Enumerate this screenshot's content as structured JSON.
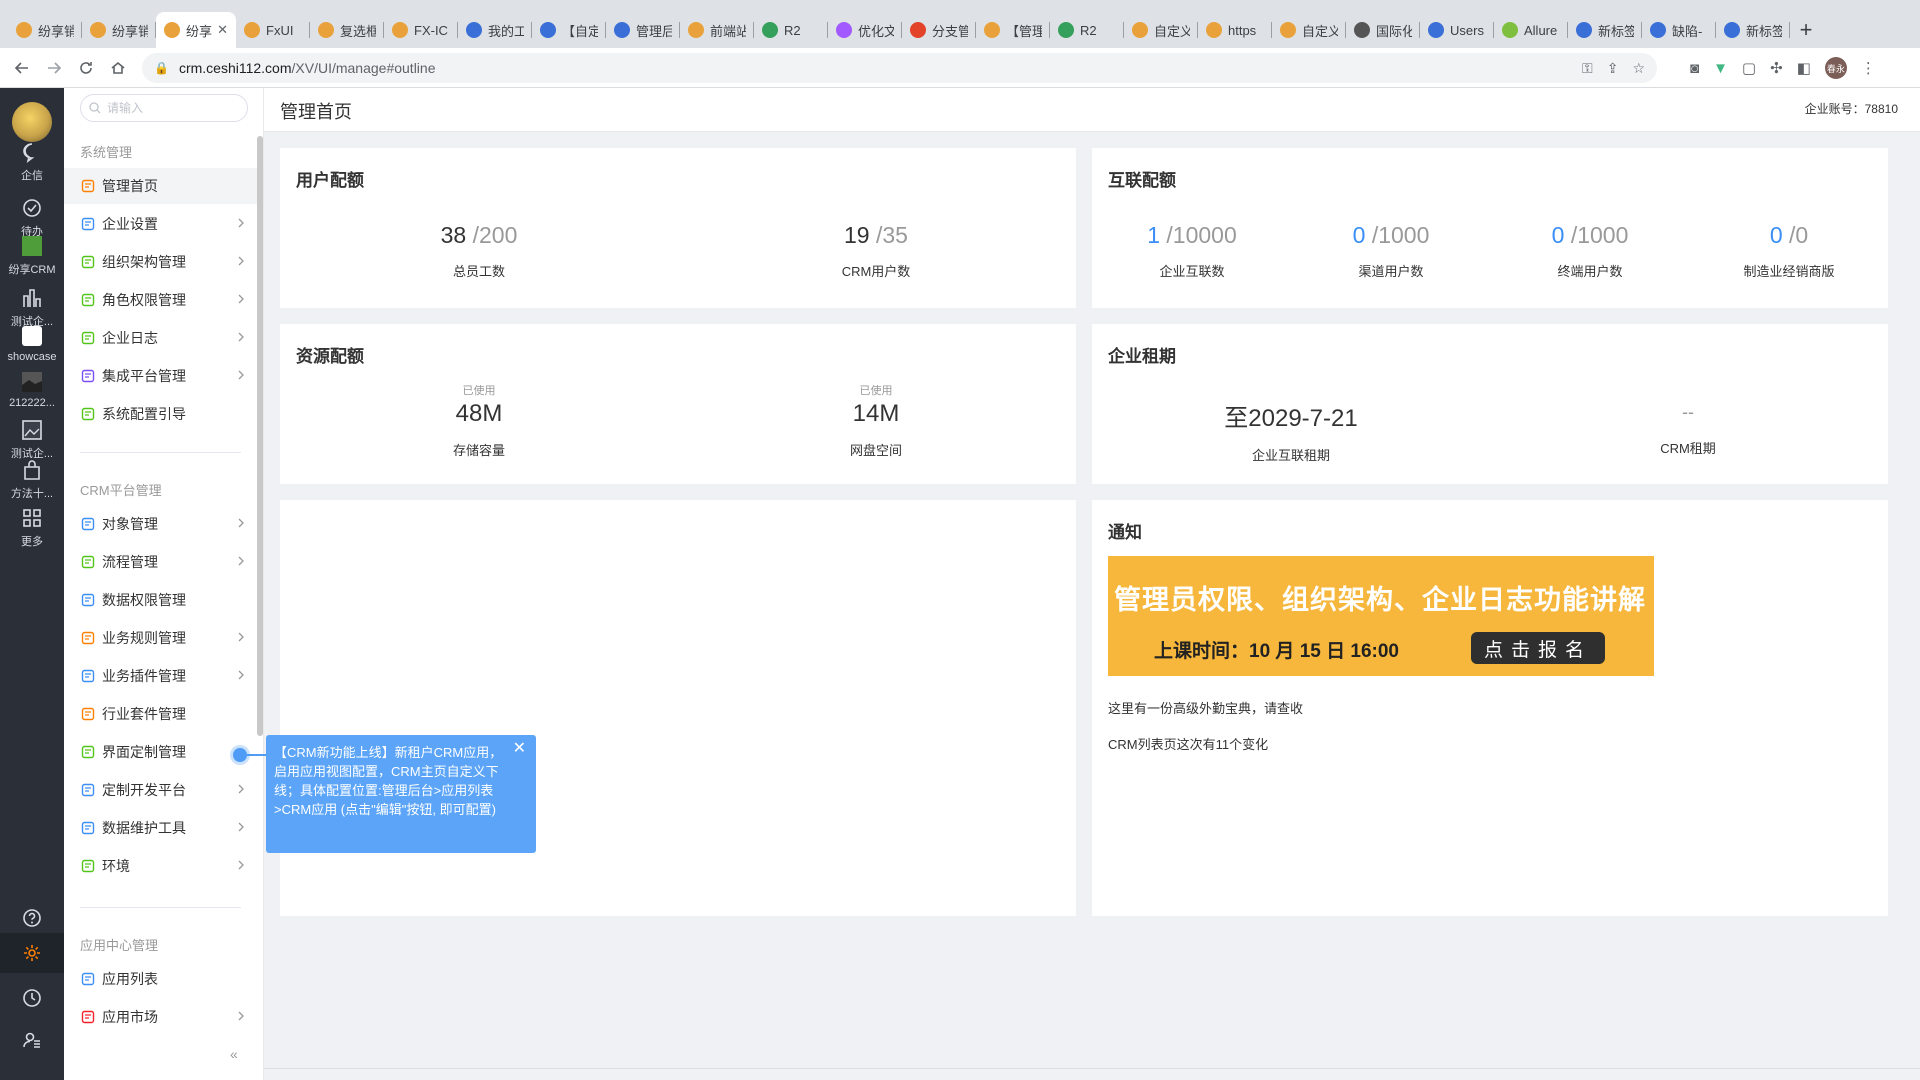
{
  "browser": {
    "tabs": [
      {
        "title": "纷享销",
        "color": "#e9a23b"
      },
      {
        "title": "纷享销",
        "color": "#e9a23b"
      },
      {
        "title": "纷享",
        "color": "#e9a23b",
        "active": true
      },
      {
        "title": "FxUI",
        "color": "#e9a23b"
      },
      {
        "title": "复选框",
        "color": "#e9a23b"
      },
      {
        "title": "FX-IC",
        "color": "#e9a23b"
      },
      {
        "title": "我的工",
        "color": "#3b6fd8"
      },
      {
        "title": "【自定",
        "color": "#3b6fd8"
      },
      {
        "title": "管理后",
        "color": "#3b6fd8"
      },
      {
        "title": "前端站",
        "color": "#e9a23b"
      },
      {
        "title": "R2",
        "color": "#35a05b"
      },
      {
        "title": "优化文",
        "color": "#a259ff"
      },
      {
        "title": "分支管",
        "color": "#e24329"
      },
      {
        "title": "【管理",
        "color": "#e9a23b"
      },
      {
        "title": "R2",
        "color": "#35a05b"
      },
      {
        "title": "自定义",
        "color": "#e9a23b"
      },
      {
        "title": "https",
        "color": "#e9a23b"
      },
      {
        "title": "自定义",
        "color": "#e9a23b"
      },
      {
        "title": "国际化",
        "color": "#555555"
      },
      {
        "title": "Users",
        "color": "#3b6fd8"
      },
      {
        "title": "Allure",
        "color": "#7fbf3f"
      },
      {
        "title": "新标签",
        "color": "#3b6fd8"
      },
      {
        "title": "缺陷-",
        "color": "#3b6fd8"
      },
      {
        "title": "新标签",
        "color": "#3b6fd8"
      }
    ],
    "tab_close": "✕",
    "new_tab": "+",
    "url_host": "crm.ceshi112.com",
    "url_path": "/XV/UI/manage#outline",
    "profile_label": "春永"
  },
  "rail": {
    "items": [
      {
        "label": "企信",
        "icon": "chat-bubble-icon"
      },
      {
        "label": "待办",
        "icon": "check-circle-icon"
      },
      {
        "label": "纷享CRM",
        "icon": "crm-app-icon"
      },
      {
        "label": "测试企...",
        "icon": "bar-chart-icon"
      },
      {
        "label": "showcase",
        "icon": "showcase-app-icon"
      },
      {
        "label": "212222...",
        "icon": "image-app-icon"
      },
      {
        "label": "测试企...",
        "icon": "picture-icon"
      },
      {
        "label": "方法十...",
        "icon": "bag-icon"
      },
      {
        "label": "更多",
        "icon": "grid-icon"
      }
    ]
  },
  "menu": {
    "search_placeholder": "请输入",
    "groups": {
      "system": "系统管理",
      "crm": "CRM平台管理",
      "app": "应用中心管理"
    },
    "system_items": [
      {
        "label": "管理首页",
        "arrow": false,
        "active": true,
        "color": "#ff8000"
      },
      {
        "label": "企业设置",
        "arrow": true,
        "color": "#3a8ef6"
      },
      {
        "label": "组织架构管理",
        "arrow": true,
        "color": "#52c41a"
      },
      {
        "label": "角色权限管理",
        "arrow": true,
        "color": "#52c41a"
      },
      {
        "label": "企业日志",
        "arrow": true,
        "color": "#52c41a"
      },
      {
        "label": "集成平台管理",
        "arrow": true,
        "color": "#7a4ff7"
      },
      {
        "label": "系统配置引导",
        "arrow": false,
        "color": "#52c41a"
      }
    ],
    "crm_items": [
      {
        "label": "对象管理",
        "arrow": true,
        "color": "#3a8ef6"
      },
      {
        "label": "流程管理",
        "arrow": true,
        "color": "#52c41a"
      },
      {
        "label": "数据权限管理",
        "arrow": false,
        "color": "#3a8ef6"
      },
      {
        "label": "业务规则管理",
        "arrow": true,
        "color": "#ff8000"
      },
      {
        "label": "业务插件管理",
        "arrow": true,
        "color": "#3a8ef6"
      },
      {
        "label": "行业套件管理",
        "arrow": false,
        "color": "#ff8000"
      },
      {
        "label": "界面定制管理",
        "arrow": false,
        "color": "#52c41a"
      },
      {
        "label": "定制开发平台",
        "arrow": true,
        "color": "#3a8ef6"
      },
      {
        "label": "数据维护工具",
        "arrow": true,
        "color": "#3a8ef6"
      },
      {
        "label": "环境",
        "arrow": true,
        "color": "#52c41a"
      }
    ],
    "app_items": [
      {
        "label": "应用列表",
        "arrow": false,
        "color": "#3a8ef6"
      },
      {
        "label": "应用市场",
        "arrow": true,
        "color": "#f5222d"
      }
    ],
    "collapse": "«"
  },
  "header": {
    "title": "管理首页",
    "account_label": "企业账号：",
    "account_value": "78810"
  },
  "user_quota": {
    "title": "用户配额",
    "stats": [
      {
        "value": "38",
        "total": "/200",
        "caption": "总员工数"
      },
      {
        "value": "19",
        "total": "/35",
        "caption": "CRM用户数"
      }
    ]
  },
  "interconnect_quota": {
    "title": "互联配额",
    "stats": [
      {
        "value": "1",
        "total": "/10000",
        "caption": "企业互联数"
      },
      {
        "value": "0",
        "total": "/1000",
        "caption": "渠道用户数"
      },
      {
        "value": "0",
        "total": "/1000",
        "caption": "终端用户数"
      },
      {
        "value": "0",
        "total": "/0",
        "caption": "制造业经销商版"
      }
    ]
  },
  "resource_quota": {
    "title": "资源配额",
    "stats": [
      {
        "used_label": "已使用",
        "value": "48M",
        "caption": "存储容量"
      },
      {
        "used_label": "已使用",
        "value": "14M",
        "caption": "网盘空间"
      }
    ]
  },
  "lease": {
    "title": "企业租期",
    "stats": [
      {
        "value": "至2029-7-21",
        "caption": "企业互联租期"
      },
      {
        "value": "--",
        "caption": "CRM租期"
      }
    ]
  },
  "notice": {
    "title": "通知",
    "banner_title": "管理员权限、组织架构、企业日志功能讲解",
    "banner_time": "上课时间：10 月 15 日  16:00",
    "banner_button": "点击报名",
    "lines": [
      "这里有一份高级外勤宝典，请查收",
      "CRM列表页这次有11个变化"
    ]
  },
  "popover": {
    "text": "【CRM新功能上线】新租户CRM应用，启用应用视图配置，CRM主页自定义下线；具体配置位置:管理后台>应用列表>CRM应用 (点击\"编辑\"按钮, 即可配置)",
    "close": "✕"
  }
}
